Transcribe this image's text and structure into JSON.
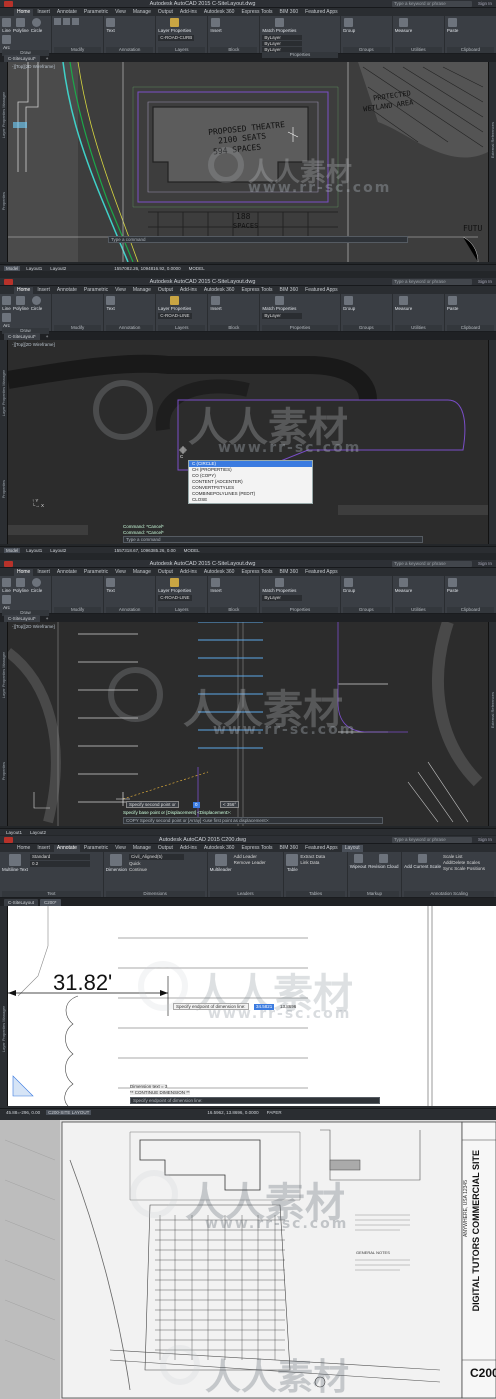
{
  "colors": {
    "accent": "#3b7be0",
    "panel_bg": "#232629",
    "ribbon_bg": "#3a3e44",
    "drawing_bg": "#2a2a2a",
    "linework_purple": "#7a4ec8"
  },
  "common_tabs": [
    "Home",
    "Insert",
    "Annotate",
    "Parametric",
    "View",
    "Manage",
    "Output",
    "Add-ins",
    "Autodesk 360",
    "Express Tools",
    "BIM 360",
    "Featured Apps"
  ],
  "ribbon_groups": [
    {
      "label": "Draw",
      "tools": [
        "Line",
        "Polyline",
        "Circle",
        "Arc"
      ]
    },
    {
      "label": "Modify",
      "tools": []
    },
    {
      "label": "Annotation",
      "tools": [
        "Text",
        "Dimension"
      ]
    },
    {
      "label": "Layers",
      "tools": [
        "Layer Properties"
      ]
    },
    {
      "label": "Block",
      "tools": [
        "Insert"
      ]
    },
    {
      "label": "Properties",
      "tools": [
        "Match Properties"
      ]
    },
    {
      "label": "Groups",
      "tools": [
        "Group"
      ]
    },
    {
      "label": "Utilities",
      "tools": [
        "Measure"
      ]
    },
    {
      "label": "Clipboard",
      "tools": [
        "Paste"
      ]
    }
  ],
  "properties_values": [
    "ByLayer",
    "ByLayer",
    "ByLayer"
  ],
  "layer_dropdown": "C-ROAD-CURB",
  "panel1": {
    "title": "Autodesk AutoCAD 2015   C-SiteLayout.dwg",
    "search_placeholder": "Type a keyword or phrase",
    "signin": "Sign In",
    "file_tab": "C-SiteLayout*",
    "sketch_text": [
      "PROPOSED THEATRE",
      "2100 SEATS",
      "594 SPACES"
    ],
    "protected_text": [
      "PROTECTED",
      "WETLAND AREA"
    ],
    "spaces_text": [
      "188",
      "SPACES"
    ],
    "futu_text": "FUTU",
    "coords": "1557082.26, 1094816.92, 0.0000",
    "model": "MODEL",
    "layout_tabs": [
      "Model",
      "Layout1",
      "Layout2"
    ],
    "command_placeholder": "Type a command",
    "viewport_label": "-][Top][2D Wireframe]"
  },
  "panel2": {
    "title": "Autodesk AutoCAD 2015   C-SiteLayout.dwg",
    "layer_dropdown": "C-ROAD-LINE",
    "file_tab": "C-SiteLayout*",
    "viewport_label": "-][Top][2D Wireframe]",
    "typed": "C",
    "autocomplete": [
      "C (CIRCLE)",
      "CH (PROPERTIES)",
      "CO (COPY)",
      "CONTENT (ADCENTER)",
      "CONVERTPSTYLES",
      "COMBINEPOLYLINES (PEDIT)",
      "CLOSE"
    ],
    "command_history": [
      "Command: *Cancel*",
      "Command: *Cancel*"
    ],
    "coords": "1557318.67, 1096385.26, 0.00",
    "model": "MODEL",
    "layout_tabs": [
      "Model",
      "Layout1",
      "Layout2"
    ]
  },
  "panel3": {
    "title": "Autodesk AutoCAD 2015   C-SiteLayout.dwg",
    "layer_dropdown": "C-ROAD-LINE",
    "file_tab": "C-SiteLayout*",
    "viewport_label": "-][Top][2D Wireframe]",
    "tooltip_prompt": "Specify second point or",
    "tooltip_val1": "0",
    "tooltip_val2": "< 356°",
    "history": "Specify base point or [Displacement] <Displacement>:",
    "command_line": "COPY Specify second point or [Array] <use first point as displacement>:",
    "layout_tabs": [
      "Layout1",
      "Layout2"
    ]
  },
  "panel4": {
    "title": "Autodesk AutoCAD 2015   C200.dwg",
    "active_tab": "Annotate",
    "tabs": [
      "Home",
      "Insert",
      "Annotate",
      "Parametric",
      "View",
      "Manage",
      "Output",
      "Add-ins",
      "Autodesk 360",
      "Express Tools",
      "BIM 360",
      "Featured Apps",
      "Layout"
    ],
    "text_style": "Standard",
    "text_height": "0.2",
    "dim_style": "Civil_Aligned(5)",
    "groups": [
      "Text",
      "Dimensions",
      "Leaders",
      "Tables",
      "Markup",
      "Annotation Scaling"
    ],
    "buttons": [
      "Multiline Text",
      "Dimension",
      "Quick",
      "Continue",
      "Multileader",
      "Add Leader",
      "Remove Leader",
      "Table",
      "Extract Data",
      "Link Data",
      "Wipeout",
      "Revision Cloud",
      "Add Current Scale",
      "Scale List",
      "Add/Delete Scales",
      "Sync Scale Positions"
    ],
    "file_tabs": [
      "C-SiteLayout",
      "C200*"
    ],
    "dimension_text": "31.82'",
    "prompt": "Specify endpoint of dimension line:",
    "prompt_value": "34.5821",
    "prompt_value2": "13.8696",
    "history": [
      "Dimension text = 3",
      "** CONTINUE DIMENSION **"
    ],
    "command_line": "Specify endpoint of dimension line:",
    "coords": "16.5962, 13.8696, 0.0000",
    "paper": "PAPER",
    "left_status": "45.88=-296, 0.00",
    "layout_tab": "C200-SITE LAYOUT"
  },
  "panel5": {
    "sheet_title": "DIGITAL TUTORS COMMERCIAL SITE",
    "sheet_sub": "ANYWHERE, USA 12345",
    "sheet_number": "C200",
    "notes_title": "GENERAL NOTES",
    "watermark_cn": "人人素材"
  },
  "watermark": {
    "cn": "人人素材",
    "url": "www.rr-sc.com"
  }
}
